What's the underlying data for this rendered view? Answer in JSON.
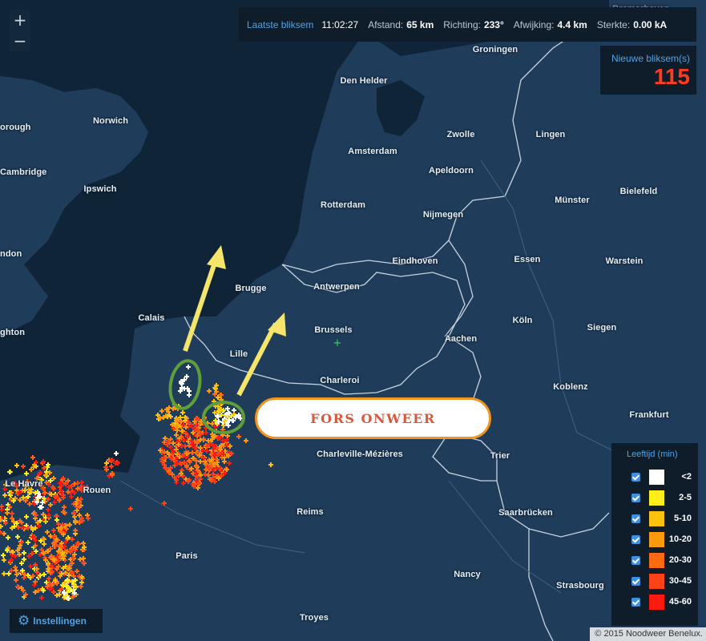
{
  "info_bar": {
    "last_label": "Laatste bliksem",
    "time": "11:02:27",
    "distance_label": "Afstand:",
    "distance": "65 km",
    "direction_label": "Richting:",
    "direction": "233°",
    "deviation_label": "Afwijking:",
    "deviation": "4.4 km",
    "strength_label": "Sterkte:",
    "strength": "0.00 kA"
  },
  "new_strikes": {
    "label": "Nieuwe bliksem(s)",
    "count": "115"
  },
  "zoom": {
    "in": "+",
    "out": "−"
  },
  "legend": {
    "title": "Leeftijd (min)",
    "items": [
      {
        "range": "<2",
        "color": "#ffffff"
      },
      {
        "range": "2-5",
        "color": "#ffee1a"
      },
      {
        "range": "5-10",
        "color": "#ffc20e"
      },
      {
        "range": "10-20",
        "color": "#ff9a0c"
      },
      {
        "range": "20-30",
        "color": "#ff6a12"
      },
      {
        "range": "30-45",
        "color": "#ff4216"
      },
      {
        "range": "45-60",
        "color": "#ff1a10"
      }
    ]
  },
  "settings": {
    "label": "Instellingen",
    "icon": "gear-icon"
  },
  "attribution": "© 2015 Noodweer Benelux.",
  "callout": "FORS ONWEER",
  "colors": {
    "sea": "#0f2436",
    "land": "#1f3d5b",
    "accent": "#4fa3e3",
    "count": "#ff3b24",
    "arrow": "#f5e56b",
    "ring": "#5f9e3a"
  },
  "cities": [
    {
      "name": "Bremerhaven"
    },
    {
      "name": "Groningen"
    },
    {
      "name": "Den Helder"
    },
    {
      "name": "orough"
    },
    {
      "name": "Norwich"
    },
    {
      "name": "Zwolle"
    },
    {
      "name": "Lingen"
    },
    {
      "name": "Amsterdam"
    },
    {
      "name": "Cambridge"
    },
    {
      "name": "Apeldoorn"
    },
    {
      "name": "Ipswich"
    },
    {
      "name": "Bielefeld"
    },
    {
      "name": "Münster"
    },
    {
      "name": "Rotterdam"
    },
    {
      "name": "Nijmegen"
    },
    {
      "name": "ndon"
    },
    {
      "name": "Eindhoven"
    },
    {
      "name": "Essen"
    },
    {
      "name": "Warstein"
    },
    {
      "name": "Brugge"
    },
    {
      "name": "Antwerpen"
    },
    {
      "name": "Calais"
    },
    {
      "name": "Köln"
    },
    {
      "name": "ghton"
    },
    {
      "name": "Brussels"
    },
    {
      "name": "Siegen"
    },
    {
      "name": "Aachen"
    },
    {
      "name": "Lille"
    },
    {
      "name": "Charleroi"
    },
    {
      "name": "Koblenz"
    },
    {
      "name": "Frankfurt"
    },
    {
      "name": "Charleville-Mézières"
    },
    {
      "name": "Trier"
    },
    {
      "name": "Le Havre"
    },
    {
      "name": "Rouen"
    },
    {
      "name": "Reims"
    },
    {
      "name": "Saarbrücken"
    },
    {
      "name": "Paris"
    },
    {
      "name": "Nancy"
    },
    {
      "name": "Strasbourg"
    },
    {
      "name": "Troyes"
    }
  ]
}
